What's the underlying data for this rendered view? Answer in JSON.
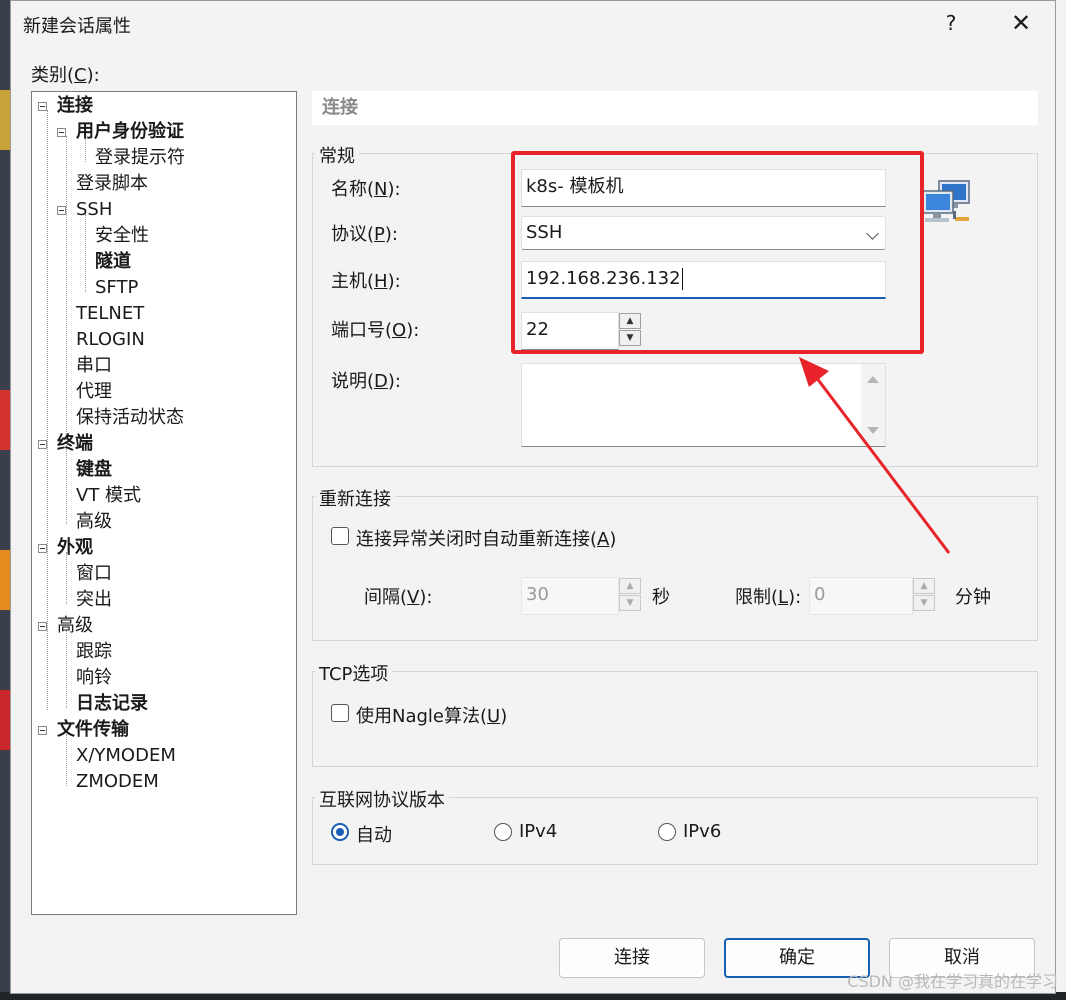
{
  "window": {
    "title": "新建会话属性",
    "help_icon": "?",
    "close_icon": "✕"
  },
  "category_label": {
    "prefix": "类别(",
    "key": "C",
    "suffix": "):"
  },
  "tree": [
    {
      "label": "连接"
    },
    {
      "label": "用户身份验证"
    },
    {
      "label": "登录提示符"
    },
    {
      "label": "登录脚本"
    },
    {
      "label": "SSH"
    },
    {
      "label": "安全性"
    },
    {
      "label": "隧道"
    },
    {
      "label": "SFTP"
    },
    {
      "label": "TELNET"
    },
    {
      "label": "RLOGIN"
    },
    {
      "label": "串口"
    },
    {
      "label": "代理"
    },
    {
      "label": "保持活动状态"
    },
    {
      "label": "终端"
    },
    {
      "label": "键盘"
    },
    {
      "label": "VT 模式"
    },
    {
      "label": "高级"
    },
    {
      "label": "外观"
    },
    {
      "label": "窗口"
    },
    {
      "label": "突出"
    },
    {
      "label": "高级"
    },
    {
      "label": "跟踪"
    },
    {
      "label": "响铃"
    },
    {
      "label": "日志记录"
    },
    {
      "label": "文件传输"
    },
    {
      "label": "X/YMODEM"
    },
    {
      "label": "ZMODEM"
    }
  ],
  "page_header": "连接",
  "general": {
    "title": "常规",
    "name_label": {
      "prefix": "名称(",
      "key": "N",
      "suffix": "):"
    },
    "name_value": "k8s- 模板机",
    "protocol_label": {
      "prefix": "协议(",
      "key": "P",
      "suffix": "):"
    },
    "protocol_value": "SSH",
    "host_label": {
      "prefix": "主机(",
      "key": "H",
      "suffix": "):"
    },
    "host_value": "192.168.236.132",
    "port_label": {
      "prefix": "端口号(",
      "key": "O",
      "suffix": "):"
    },
    "port_value": "22",
    "desc_label": {
      "prefix": "说明(",
      "key": "D",
      "suffix": "):"
    },
    "desc_value": ""
  },
  "reconnect": {
    "title": "重新连接",
    "auto_label": {
      "prefix": "连接异常关闭时自动重新连接(",
      "key": "A",
      "suffix": ")"
    },
    "auto_checked": false,
    "interval_label": {
      "prefix": "间隔(",
      "key": "V",
      "suffix": "):"
    },
    "interval_value": "30",
    "interval_unit": "秒",
    "limit_label": {
      "prefix": "限制(",
      "key": "L",
      "suffix": "):"
    },
    "limit_value": "0",
    "limit_unit": "分钟"
  },
  "tcp": {
    "title": "TCP选项",
    "nagle_label": {
      "prefix": "使用Nagle算法(",
      "key": "U",
      "suffix": ")"
    },
    "nagle_checked": false
  },
  "ip_version": {
    "title": "互联网协议版本",
    "options": [
      "自动",
      "IPv4",
      "IPv6"
    ],
    "selected": "自动"
  },
  "buttons": {
    "connect": "连接",
    "ok": "确定",
    "cancel": "取消"
  },
  "watermark": "CSDN @我在学习真的在学习",
  "colors": {
    "accent": "#1a5fb4",
    "annotation": "#e8242a"
  }
}
